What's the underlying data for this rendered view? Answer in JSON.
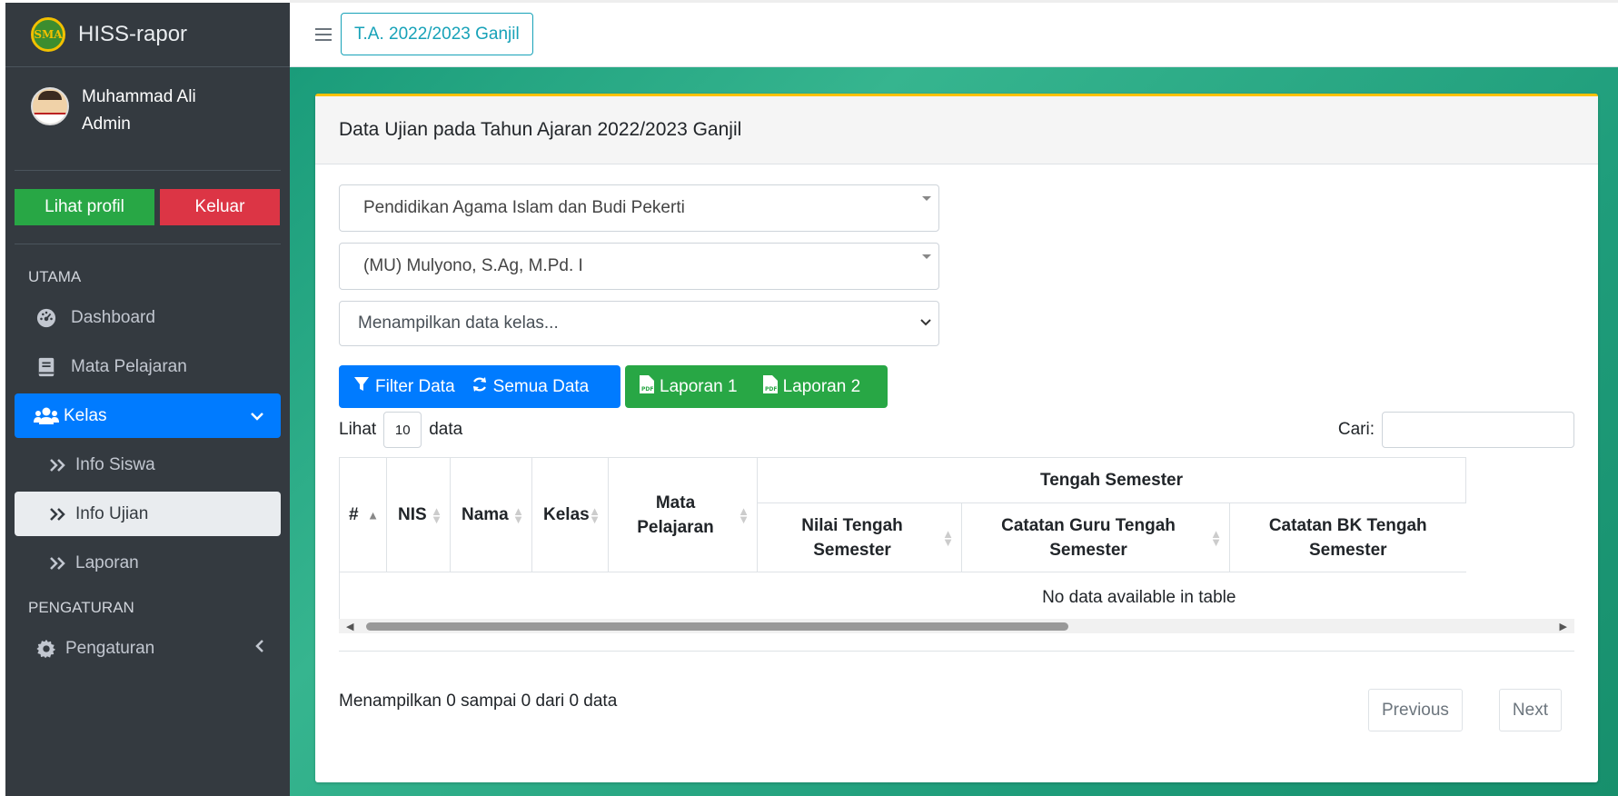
{
  "sidebar": {
    "brand": {
      "logo_text": "SMA",
      "title": "HISS-rapor"
    },
    "user": {
      "name": "Muhammad Ali",
      "role": "Admin"
    },
    "buttons": {
      "profile": "Lihat profil",
      "logout": "Keluar"
    },
    "sections": [
      {
        "header": "UTAMA"
      },
      {
        "header": "PENGATURAN"
      }
    ],
    "items": [
      {
        "label": "Dashboard",
        "icon": "tachometer-icon"
      },
      {
        "label": "Mata Pelajaran",
        "icon": "book-icon"
      },
      {
        "label": "Kelas",
        "icon": "users-icon"
      },
      {
        "label": "Info Siswa",
        "icon": "angle-double-right-icon"
      },
      {
        "label": "Info Ujian",
        "icon": "angle-double-right-icon"
      },
      {
        "label": "Laporan",
        "icon": "angle-double-right-icon"
      },
      {
        "label": "Pengaturan",
        "icon": "gear-icon"
      }
    ],
    "colors": {
      "bg": "#343a40",
      "active": "#007bff"
    }
  },
  "topbar": {
    "year_button": "T.A. 2022/2023 Ganjil"
  },
  "card": {
    "title": "Data Ujian pada Tahun Ajaran 2022/2023 Ganjil",
    "select_subject": "Pendidikan Agama Islam dan Budi Pekerti",
    "select_teacher": "(MU) Mulyono, S.Ag, M.Pd. I",
    "select_class": "Menampilkan data kelas...",
    "buttons": {
      "filter": "Filter Data",
      "all": "Semua Data",
      "report1": "Laporan 1",
      "report2": "Laporan 2"
    },
    "length": {
      "prefix": "Lihat",
      "value": "10",
      "suffix": "data"
    },
    "search_label": "Cari:",
    "table": {
      "headers": {
        "num": "#",
        "nis": "NIS",
        "nama": "Nama",
        "kelas": "Kelas",
        "mapel": "Mata Pelajaran",
        "group": "Tengah Semester",
        "nilai": "Nilai Tengah Semester",
        "catatan_guru": "Catatan Guru Tengah Semester",
        "catatan_bk": "Catatan BK Tengah Semester"
      },
      "empty": "No data available in table"
    },
    "info": "Menampilkan 0 sampai 0 dari 0 data",
    "pager": {
      "prev": "Previous",
      "next": "Next"
    }
  }
}
